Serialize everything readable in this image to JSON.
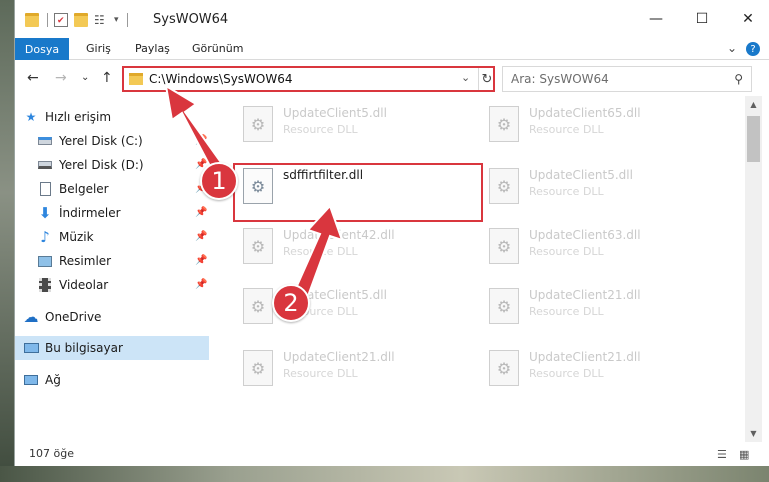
{
  "window": {
    "title": "SysWOW64",
    "controls": {
      "minimize": "—",
      "maximize": "☐",
      "close": "✕"
    }
  },
  "ribbon": {
    "tabs": [
      "Dosya",
      "Giriş",
      "Paylaş",
      "Görünüm"
    ],
    "expand_glyph": "⌄",
    "help_glyph": "?"
  },
  "address": {
    "path": "C:\\Windows\\SysWOW64",
    "refresh_glyph": "↻",
    "dropdown_glyph": "⌄"
  },
  "nav": {
    "back": "←",
    "forward": "→",
    "recent": "⌄",
    "up": "↑"
  },
  "search": {
    "placeholder": "Ara: SysWOW64",
    "icon_glyph": "⚲"
  },
  "sidebar": {
    "quick_access": "Hızlı erişim",
    "items": [
      {
        "label": "Yerel Disk (C:)",
        "icon": "drive-icon",
        "pinned": true
      },
      {
        "label": "Yerel Disk (D:)",
        "icon": "drive-icon",
        "pinned": true
      },
      {
        "label": "Belgeler",
        "icon": "documents-icon",
        "pinned": true
      },
      {
        "label": "İndirmeler",
        "icon": "download-icon",
        "pinned": true
      },
      {
        "label": "Müzik",
        "icon": "music-icon",
        "pinned": true
      },
      {
        "label": "Resimler",
        "icon": "pictures-icon",
        "pinned": true
      },
      {
        "label": "Videolar",
        "icon": "videos-icon",
        "pinned": true
      }
    ],
    "onedrive": "OneDrive",
    "this_pc": "Bu bilgisayar",
    "network": "Ağ"
  },
  "files": {
    "items": [
      {
        "name": "UpdateClient5.dll",
        "type": "Resource DLL"
      },
      {
        "name": "UpdateClient65.dll",
        "type": "Resource DLL"
      },
      {
        "name": "sdffirtfilter.dll",
        "type": ""
      },
      {
        "name": "UpdateClient5.dll",
        "type": "Resource DLL"
      },
      {
        "name": "UpdateClient42.dll",
        "type": "Resource DLL"
      },
      {
        "name": "UpdateClient63.dll",
        "type": "Resource DLL"
      },
      {
        "name": "UpdateClient5.dll",
        "type": "Resource DLL"
      },
      {
        "name": "UpdateClient21.dll",
        "type": "Resource DLL"
      },
      {
        "name": "UpdateClient21.dll",
        "type": "Resource DLL"
      },
      {
        "name": "UpdateClient21.dll",
        "type": "Resource DLL"
      }
    ]
  },
  "status": {
    "count": "107 öğe"
  },
  "callouts": {
    "one": "1",
    "two": "2"
  },
  "colors": {
    "accent": "#1979ca",
    "highlight": "#d9363e",
    "selected": "#cce4f7"
  }
}
